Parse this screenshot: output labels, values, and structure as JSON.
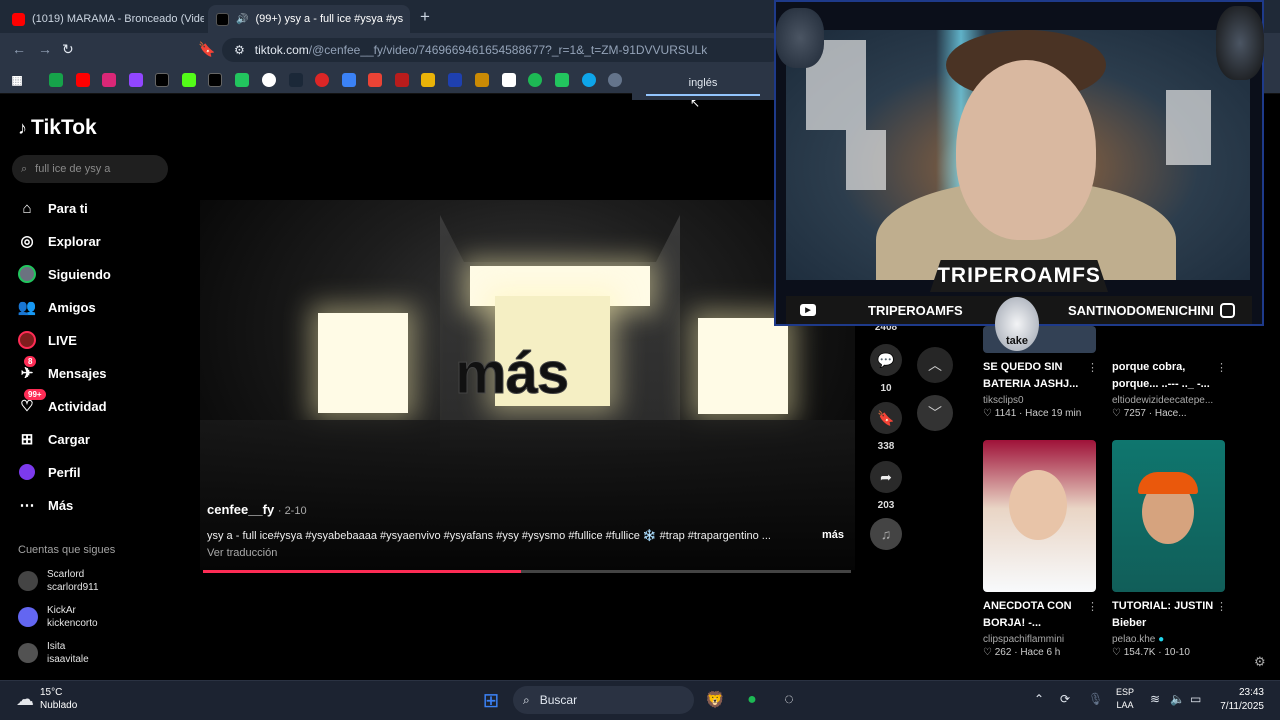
{
  "browser": {
    "tabs": [
      {
        "title": "(1019) MARAMA - Bronceado (Video",
        "active": false
      },
      {
        "title": "(99+) ysy a - full ice #ysya #ys",
        "active": true
      }
    ],
    "new_tab_label": "+",
    "url_domain": "tiktok.com",
    "url_path": "/@cenfee__fy/video/7469669461654588677?_r=1&_t=ZM-91DVVURSULk",
    "translate_popup": "inglés"
  },
  "sidebar": {
    "logo": "TikTok",
    "search_placeholder": "full ice de ysy a",
    "nav": [
      {
        "label": "Para ti",
        "icon": "home-icon"
      },
      {
        "label": "Explorar",
        "icon": "compass-icon"
      },
      {
        "label": "Siguiendo",
        "icon": "following-avatar-icon"
      },
      {
        "label": "Amigos",
        "icon": "friends-icon"
      },
      {
        "label": "LIVE",
        "icon": "live-icon"
      },
      {
        "label": "Mensajes",
        "icon": "messages-icon",
        "badge": "8"
      },
      {
        "label": "Actividad",
        "icon": "activity-icon",
        "badge": "99+"
      },
      {
        "label": "Cargar",
        "icon": "upload-icon"
      },
      {
        "label": "Perfil",
        "icon": "profile-icon"
      },
      {
        "label": "Más",
        "icon": "more-icon"
      }
    ],
    "following_header": "Cuentas que sigues",
    "following": [
      {
        "name": "Scarlord",
        "handle": "scarlord911"
      },
      {
        "name": "KickAr",
        "handle": "kickencorto"
      },
      {
        "name": "Isita",
        "handle": "isaavitale"
      }
    ]
  },
  "video": {
    "overlay_text": "más",
    "author": "cenfee__fy",
    "date": "· 2-10",
    "description": "ysy a - full ice#ysya #ysyabebaaaa #ysyaenvivo #ysyafans #ysy #ysysmo #fullice #fullice ❄️ #trap #trapargentino ...",
    "more_label": "más",
    "translate_label": "Ver traducción",
    "progress": 0.49
  },
  "actions": {
    "likes": "2408",
    "comments": "10",
    "saves": "338",
    "shares": "203"
  },
  "related": [
    {
      "title": "SE QUEDO SIN BATERIA JASHJ...",
      "user": "tiksclips0",
      "likes": "1141",
      "time": "Hace 19 min"
    },
    {
      "title": "porque cobra, porque... ..--- .._ -...",
      "user": "eltiodewizideecatepe...",
      "likes": "7257",
      "time": "Hace..."
    },
    {
      "title": "ANECDOTA CON BORJA! -...",
      "user": "clipspachiflammini",
      "likes": "262",
      "time": "Hace 6 h"
    },
    {
      "title": "TUTORIAL: JUSTIN Bieber",
      "user": "pelao.khe",
      "likes": "154.7K",
      "time": "10-10"
    }
  ],
  "stream_overlay": {
    "name": "TRIPEROAMFS",
    "youtube": "TRIPEROAMFS",
    "instagram": "SANTINODOMENICHINI",
    "badge_text": "take"
  },
  "taskbar": {
    "weather_temp": "15°C",
    "weather_desc": "Nublado",
    "search_label": "Buscar",
    "lang_line1": "ESP",
    "lang_line2": "LAA",
    "time": "23:43",
    "date": "7/11/2025"
  },
  "colors": {
    "tiktok_red": "#fe2c55",
    "browser_bg": "#2b3545",
    "taskbar_bg": "#1c2331"
  }
}
